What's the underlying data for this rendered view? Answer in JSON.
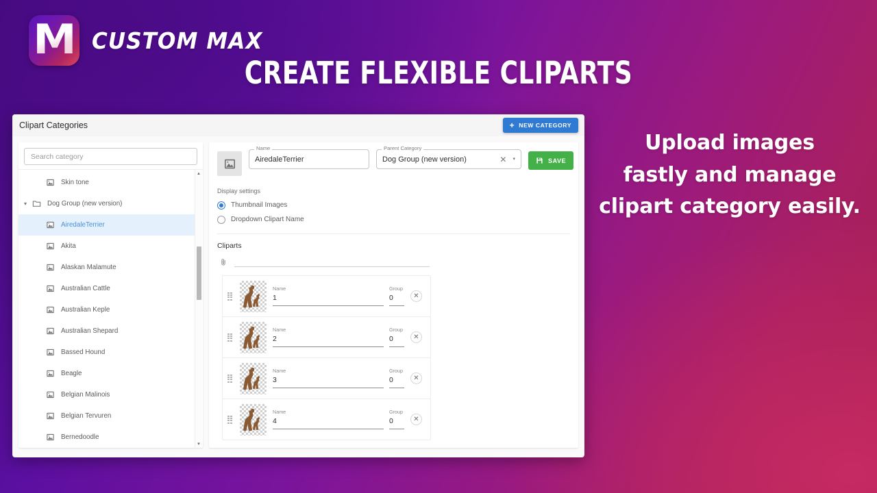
{
  "brand": {
    "name": "CUSTOM MAX",
    "logo_letter": "M"
  },
  "headline": "CREATE FLEXIBLE CLIPARTS",
  "promo": {
    "line1": "Upload images",
    "line2": "fastly and manage",
    "line3": "clipart category easily."
  },
  "colors": {
    "accent_blue": "#2f7bd4",
    "save_green": "#43b048",
    "selected_row_bg": "#e4f0fb",
    "selected_row_text": "#4a90d9"
  },
  "app": {
    "title": "Clipart Categories",
    "new_category_button": "NEW CATEGORY",
    "search": {
      "placeholder": "Search category",
      "value": ""
    },
    "tree": [
      {
        "label": "Skin tone",
        "icon": "image-icon",
        "indent": "lead",
        "selected": false,
        "caret": ""
      },
      {
        "label": "Dog Group (new version)",
        "icon": "folder-icon",
        "indent": "group",
        "selected": false,
        "caret": "▾"
      },
      {
        "label": "AiredaleTerrier",
        "icon": "image-icon",
        "indent": "child",
        "selected": true,
        "caret": ""
      },
      {
        "label": "Akita",
        "icon": "image-icon",
        "indent": "child",
        "selected": false,
        "caret": ""
      },
      {
        "label": "Alaskan Malamute",
        "icon": "image-icon",
        "indent": "child",
        "selected": false,
        "caret": ""
      },
      {
        "label": "Australian Cattle",
        "icon": "image-icon",
        "indent": "child",
        "selected": false,
        "caret": ""
      },
      {
        "label": "Australian Keple",
        "icon": "image-icon",
        "indent": "child",
        "selected": false,
        "caret": ""
      },
      {
        "label": "Australian Shepard",
        "icon": "image-icon",
        "indent": "child",
        "selected": false,
        "caret": ""
      },
      {
        "label": "Bassed Hound",
        "icon": "image-icon",
        "indent": "child",
        "selected": false,
        "caret": ""
      },
      {
        "label": "Beagle",
        "icon": "image-icon",
        "indent": "child",
        "selected": false,
        "caret": ""
      },
      {
        "label": "Belgian Malinois",
        "icon": "image-icon",
        "indent": "child",
        "selected": false,
        "caret": ""
      },
      {
        "label": "Belgian Tervuren",
        "icon": "image-icon",
        "indent": "child",
        "selected": false,
        "caret": ""
      },
      {
        "label": "Bernedoodle",
        "icon": "image-icon",
        "indent": "child",
        "selected": false,
        "caret": ""
      }
    ],
    "detail": {
      "name_field": {
        "legend": "Name",
        "value": "AiredaleTerrier"
      },
      "parent_field": {
        "legend": "Parent Category",
        "value": "Dog Group (new version)",
        "clear_icon": "✕",
        "caret_icon": "▾"
      },
      "save_button": "SAVE",
      "display_settings_label": "Display settings",
      "radios": [
        {
          "label": "Thumbnail Images",
          "selected": true
        },
        {
          "label": "Dropdown Clipart Name",
          "selected": false
        }
      ],
      "cliparts_title": "Cliparts",
      "clipart_rows": [
        {
          "name_label": "Name",
          "name_value": "1",
          "group_label": "Group",
          "group_value": "0",
          "remove_icon": "✕"
        },
        {
          "name_label": "Name",
          "name_value": "2",
          "group_label": "Group",
          "group_value": "0",
          "remove_icon": "✕"
        },
        {
          "name_label": "Name",
          "name_value": "3",
          "group_label": "Group",
          "group_value": "0",
          "remove_icon": "✕"
        },
        {
          "name_label": "Name",
          "name_value": "4",
          "group_label": "Group",
          "group_value": "0",
          "remove_icon": "✕"
        }
      ]
    }
  }
}
